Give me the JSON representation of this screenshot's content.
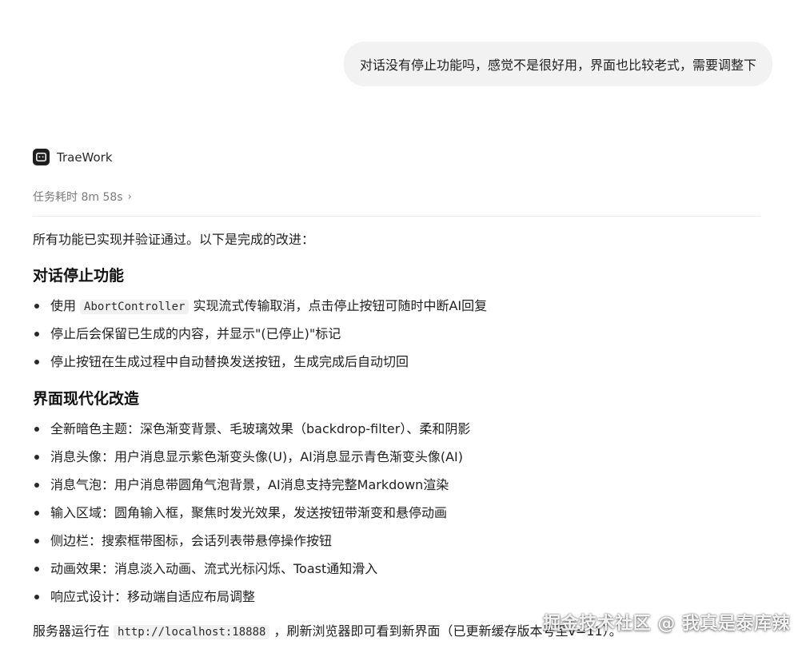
{
  "user_message": "对话没有停止功能吗，感觉不是很好用，界面也比较老式，需要调整下",
  "assistant": {
    "name": "TraeWork",
    "task_time": "任务耗时 8m 58s"
  },
  "response": {
    "intro": "所有功能已实现并验证通过。以下是完成的改进：",
    "section_stop": {
      "title": "对话停止功能",
      "item1_pre": "使用",
      "item1_code": "AbortController",
      "item1_post": "实现流式传输取消，点击停止按钮可随时中断AI回复",
      "item2": "停止后会保留已生成的内容，并显示\"(已停止)\"标记",
      "item3": "停止按钮在生成过程中自动替换发送按钮，生成完成后自动切回"
    },
    "section_ui": {
      "title": "界面现代化改造",
      "items": [
        "全新暗色主题：深色渐变背景、毛玻璃效果（backdrop-filter）、柔和阴影",
        "消息头像：用户消息显示紫色渐变头像(U)，AI消息显示青色渐变头像(AI)",
        "消息气泡：用户消息带圆角气泡背景，AI消息支持完整Markdown渲染",
        "输入区域：圆角输入框，聚焦时发光效果，发送按钮带渐变和悬停动画",
        "侧边栏：搜索框带图标，会话列表带悬停操作按钮",
        "动画效果：消息淡入动画、流式光标闪烁、Toast通知滑入",
        "响应式设计：移动端自适应布局调整"
      ]
    },
    "footer_pre": "服务器运行在",
    "footer_code": "http://localhost:18888",
    "footer_post": "，刷新浏览器即可看到新界面（已更新缓存版本号至v=11）。"
  },
  "watermark": "掘金技术社区 @ 我真是泰库辣"
}
